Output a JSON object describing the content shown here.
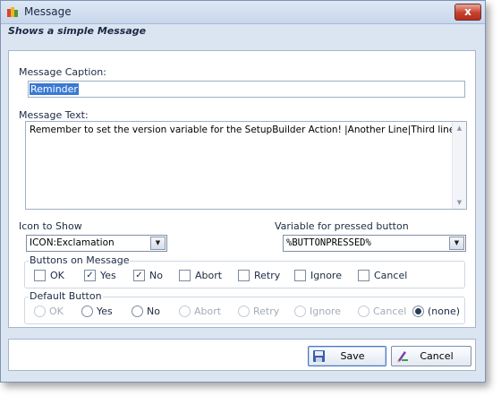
{
  "window": {
    "title": "Message",
    "subtitle": "Shows a simple Message",
    "close_symbol": "x"
  },
  "caption": {
    "label": "Message Caption:",
    "value": "Reminder"
  },
  "text": {
    "label": "Message Text:",
    "value": "Remember to set the version variable for the SetupBuilder Action! |Another Line|Third line."
  },
  "icon_select": {
    "label": "Icon to Show",
    "value": "ICON:Exclamation"
  },
  "variable_select": {
    "label": "Variable for pressed button",
    "value": "%BUTTONPRESSED%"
  },
  "buttons_group": {
    "title": "Buttons on Message",
    "items": [
      {
        "label": "OK",
        "checked": false
      },
      {
        "label": "Yes",
        "checked": true
      },
      {
        "label": "No",
        "checked": true
      },
      {
        "label": "Abort",
        "checked": false
      },
      {
        "label": "Retry",
        "checked": false
      },
      {
        "label": "Ignore",
        "checked": false
      },
      {
        "label": "Cancel",
        "checked": false
      }
    ]
  },
  "default_group": {
    "title": "Default Button",
    "items": [
      {
        "label": "OK",
        "enabled": false,
        "selected": false
      },
      {
        "label": "Yes",
        "enabled": true,
        "selected": false
      },
      {
        "label": "No",
        "enabled": true,
        "selected": false
      },
      {
        "label": "Abort",
        "enabled": false,
        "selected": false
      },
      {
        "label": "Retry",
        "enabled": false,
        "selected": false
      },
      {
        "label": "Ignore",
        "enabled": false,
        "selected": false
      },
      {
        "label": "Cancel",
        "enabled": false,
        "selected": false
      },
      {
        "label": "(none)",
        "enabled": true,
        "selected": true
      }
    ]
  },
  "actions": {
    "save_label": "Save",
    "cancel_label": "Cancel"
  }
}
